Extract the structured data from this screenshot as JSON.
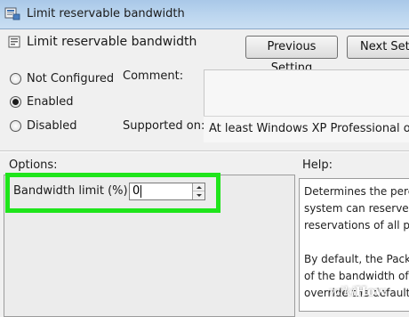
{
  "window": {
    "title": "Limit reservable bandwidth",
    "icon": "policy-icon"
  },
  "header": {
    "title": "Limit reservable bandwidth",
    "icon": "setting-icon"
  },
  "nav": {
    "previous_label": "Previous Setting",
    "next_label": "Next Setti"
  },
  "state": {
    "options": [
      {
        "label": "Not Configured",
        "checked": false
      },
      {
        "label": "Enabled",
        "checked": true
      },
      {
        "label": "Disabled",
        "checked": false
      }
    ]
  },
  "comment": {
    "label": "Comment:",
    "value": ""
  },
  "supported": {
    "label": "Supported on:",
    "value": "At least Windows XP Professional or Wi"
  },
  "options_section": {
    "heading": "Options:",
    "bandwidth_label": "Bandwidth limit (%):",
    "bandwidth_value": "0",
    "highlight_color": "#1fe51b"
  },
  "help_section": {
    "heading": "Help:",
    "lines": [
      "Determines the perce",
      "system can reserve. T",
      "reservations of all pro",
      "",
      "By default, the Packe",
      "of the bandwidth of",
      "override the default."
    ]
  },
  "watermark": {
    "part1": "wiki",
    "part2": "How"
  }
}
